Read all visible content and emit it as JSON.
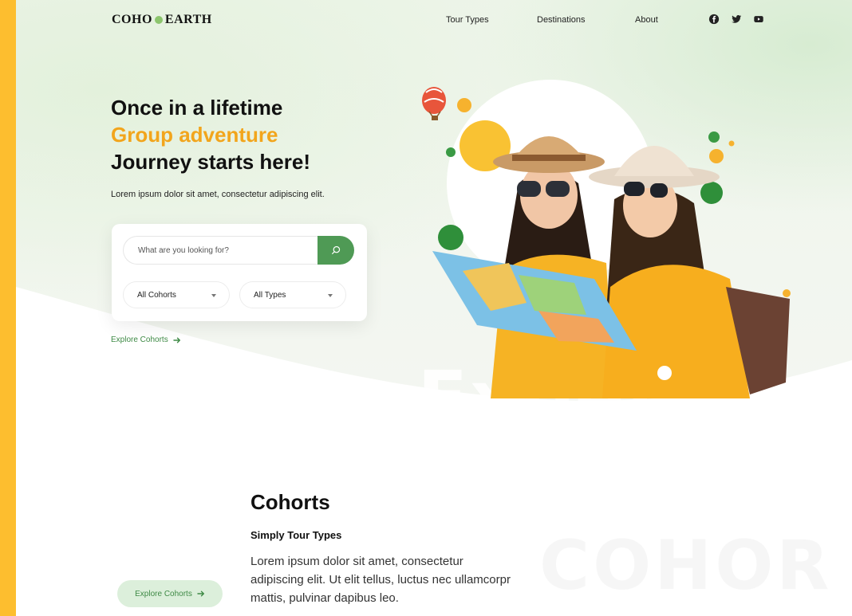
{
  "brand": {
    "name_left": "COHO",
    "name_right": "EARTH",
    "dot_color": "#8cc56d"
  },
  "nav": {
    "items": [
      "Tour Types",
      "Destinations",
      "About"
    ]
  },
  "social": {
    "icons": [
      "facebook-icon",
      "twitter-icon",
      "youtube-icon"
    ]
  },
  "hero": {
    "line1": "Once in a lifetime",
    "line2": "Group adventure",
    "line3": "Journey starts here!",
    "subtitle": "Lorem ipsum dolor sit amet, consectetur adipiscing elit.",
    "watermark": "Lifetime Experience"
  },
  "search": {
    "placeholder": "What are you looking for?",
    "filters": [
      "All Cohorts",
      "All Types"
    ]
  },
  "explore_link": "Explore Cohorts",
  "cohorts": {
    "title": "Cohorts",
    "subtitle": "Simply Tour Types",
    "body": "Lorem ipsum dolor sit amet, consectetur adipiscing elit. Ut elit tellus, luctus nec ullamcorpr mattis, pulvinar dapibus leo.",
    "button": "Explore Cohorts",
    "watermark": "COHOR"
  },
  "colors": {
    "accent": "#F2A51C",
    "primary_green": "#4F9A55",
    "side_bar": "#FDBE2F"
  }
}
